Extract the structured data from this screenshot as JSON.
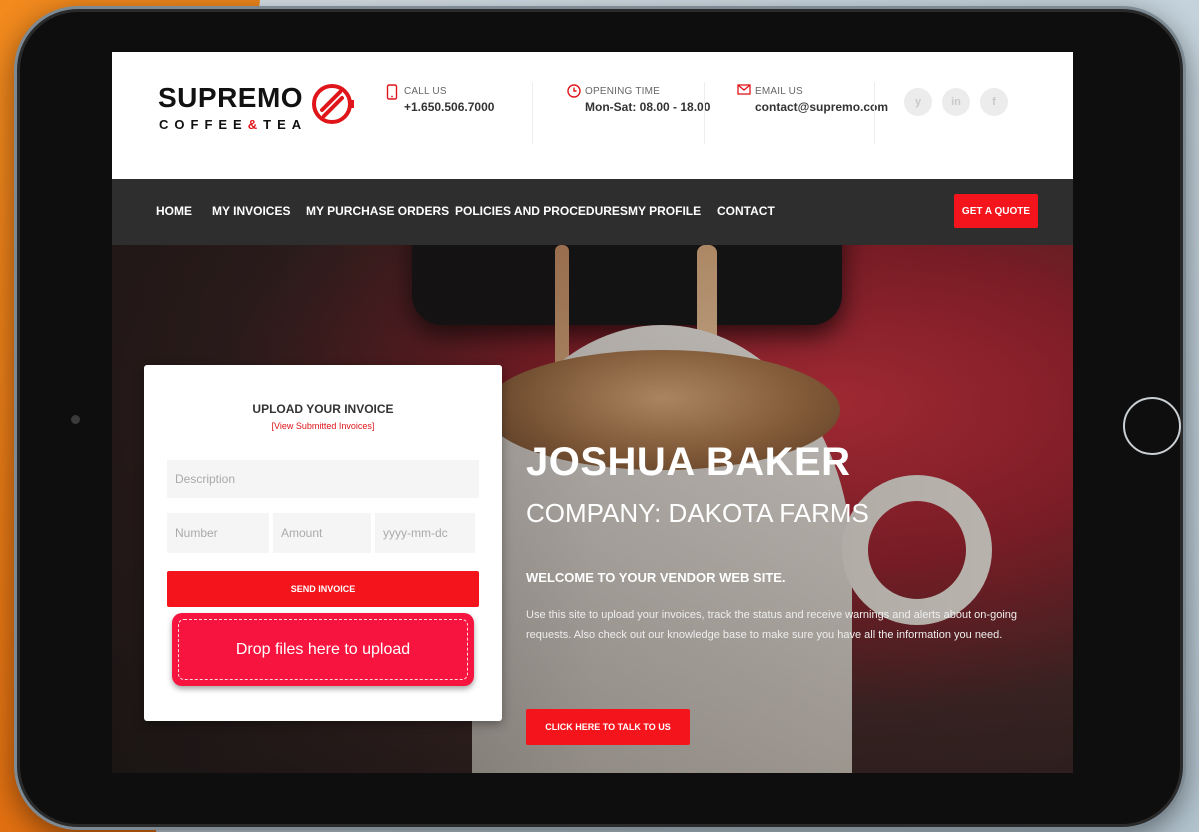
{
  "brand": {
    "name": "SUPREMO",
    "sub_prefix": "COFFEE",
    "sub_amp": "&",
    "sub_suffix": "TEA",
    "accent": "#f3151b"
  },
  "contact": [
    {
      "label": "CALL US",
      "value": "+1.650.506.7000",
      "icon": "phone-icon"
    },
    {
      "label": "OPENING TIME",
      "value": "Mon-Sat: 08.00 - 18.00",
      "icon": "clock-icon"
    },
    {
      "label": "EMAIL US",
      "value": "contact@supremo.com",
      "icon": "mail-icon"
    }
  ],
  "social": [
    "y",
    "in",
    "f"
  ],
  "nav": {
    "items": [
      "HOME",
      "MY INVOICES",
      "MY PURCHASE ORDERS",
      "POLICIES AND PROCEDURES",
      "MY PROFILE",
      "CONTACT"
    ],
    "cta": "GET A QUOTE"
  },
  "upload": {
    "title": "UPLOAD YOUR INVOICE",
    "link": "[View Submitted Invoices]",
    "description_placeholder": "Description",
    "number_placeholder": "Number",
    "amount_placeholder": "Amount",
    "date_placeholder": "yyyy-mm-dc",
    "send_label": "SEND INVOICE",
    "drop_label": "Drop files here to upload"
  },
  "hero": {
    "name": "JOSHUA BAKER",
    "company": "COMPANY: DAKOTA FARMS",
    "welcome": "WELCOME TO YOUR VENDOR WEB SITE.",
    "body": "Use this site to upload your invoices, track the status and receive warnings and alerts about on-going requests. Also check out our knowledge base to make sure you have all the information you need.",
    "cta": "CLICK HERE TO TALK TO US"
  }
}
